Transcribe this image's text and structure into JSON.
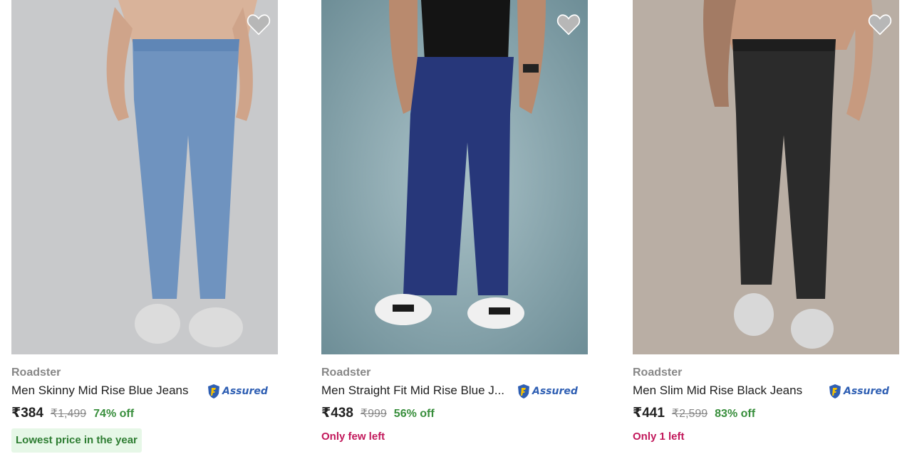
{
  "products": [
    {
      "brand": "Roadster",
      "title": "Men Skinny Mid Rise Blue Jeans",
      "assured_label": "Assured",
      "price": "₹384",
      "mrp": "₹1,499",
      "discount": "74% off",
      "tag": "Lowest price in the year"
    },
    {
      "brand": "Roadster",
      "title": "Men Straight Fit Mid Rise Blue J...",
      "assured_label": "Assured",
      "price": "₹438",
      "mrp": "₹999",
      "discount": "56% off",
      "tag": "Only few left"
    },
    {
      "brand": "Roadster",
      "title": "Men Slim Mid Rise Black Jeans",
      "assured_label": "Assured",
      "price": "₹441",
      "mrp": "₹2,599",
      "discount": "83% off",
      "tag": "Only 1 left"
    }
  ],
  "colors": {
    "assured_blue": "#2f5fb3",
    "discount_green": "#388e3c",
    "stock_pink": "#c2185b",
    "lowest_bg": "#e6f7e7"
  },
  "icons": [
    "heart-icon",
    "assured-shield-icon"
  ]
}
